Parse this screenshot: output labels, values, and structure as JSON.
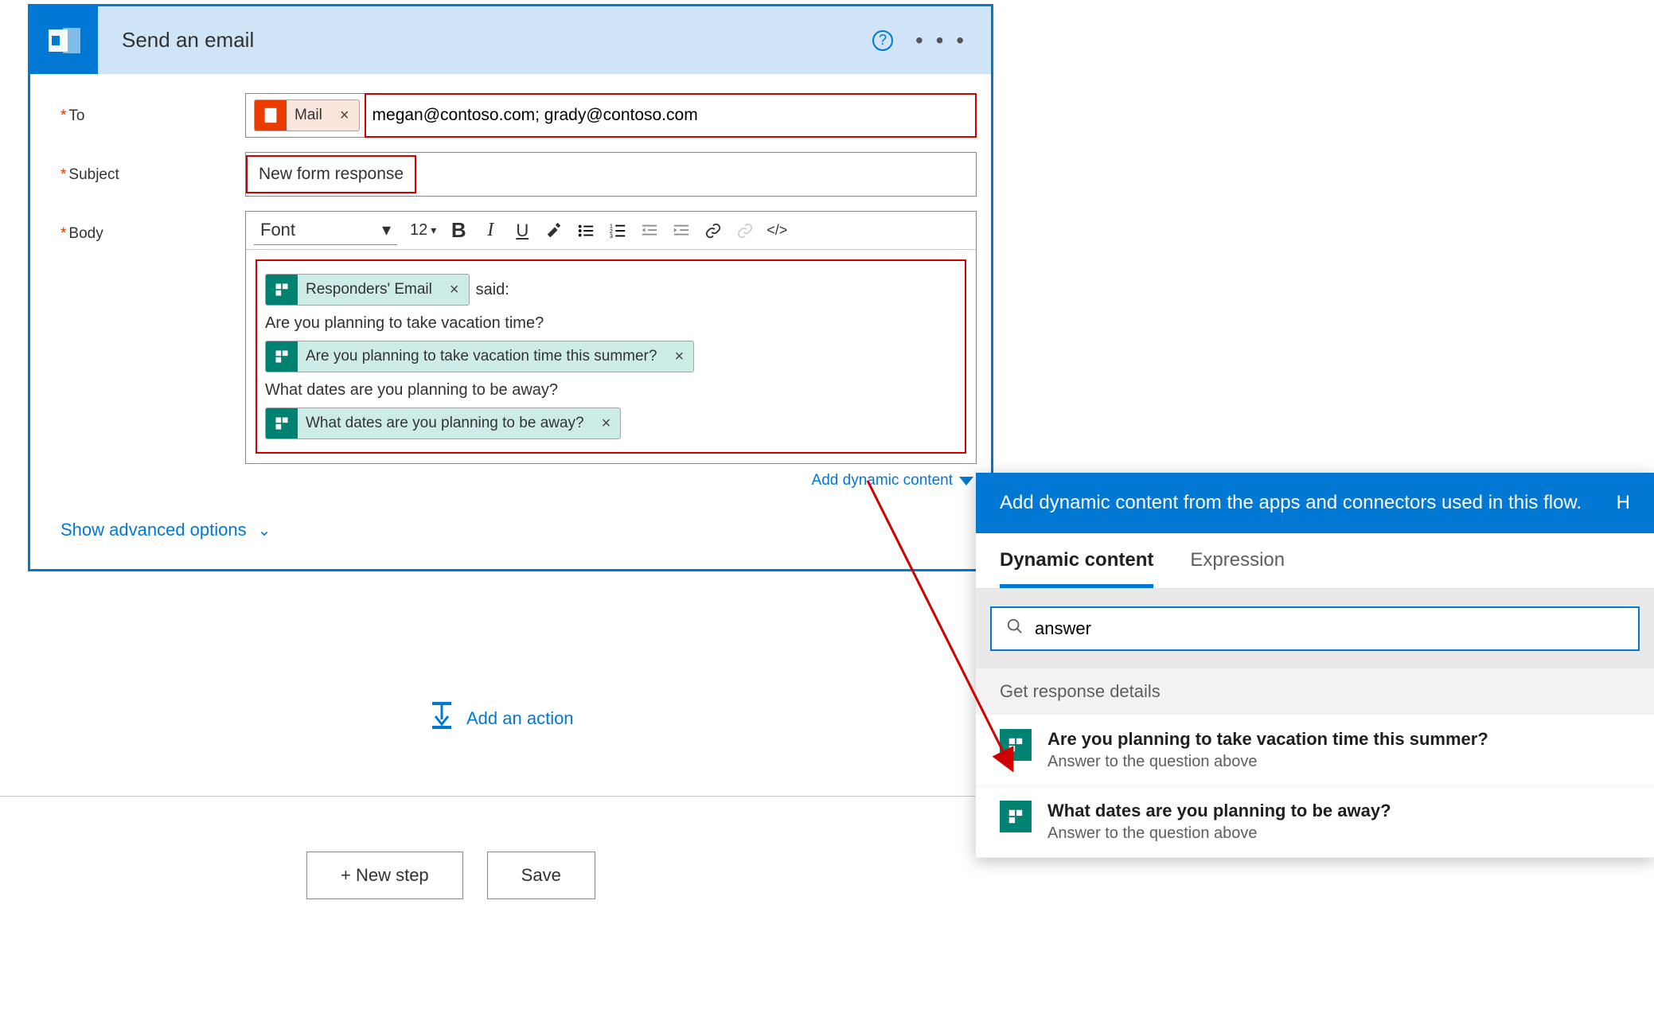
{
  "card": {
    "title": "Send an email",
    "to_label": "To",
    "to_token": "Mail",
    "to_value": "megan@contoso.com; grady@contoso.com",
    "subject_label": "Subject",
    "subject_value": "New form response",
    "body_label": "Body",
    "font_label": "Font",
    "font_size": "12",
    "body_token1": "Responders' Email",
    "body_text1": "said:",
    "body_line2": "Are you planning to take vacation time?",
    "body_token2": "Are you planning to take vacation time this summer?",
    "body_line3": "What dates are you planning to be away?",
    "body_token3": "What dates are you planning to be away?",
    "add_dynamic": "Add dynamic content",
    "adv_options": "Show advanced options",
    "add_action": "Add an action"
  },
  "buttons": {
    "new_step": "+ New step",
    "save": "Save"
  },
  "dc": {
    "header": "Add dynamic content from the apps and connectors used in this flow.",
    "header_right": "H",
    "tab1": "Dynamic content",
    "tab2": "Expression",
    "search_value": "answer",
    "section": "Get response details",
    "item1_title": "Are you planning to take vacation time this summer?",
    "item1_sub": "Answer to the question above",
    "item2_title": "What dates are you planning to be away?",
    "item2_sub": "Answer to the question above"
  }
}
